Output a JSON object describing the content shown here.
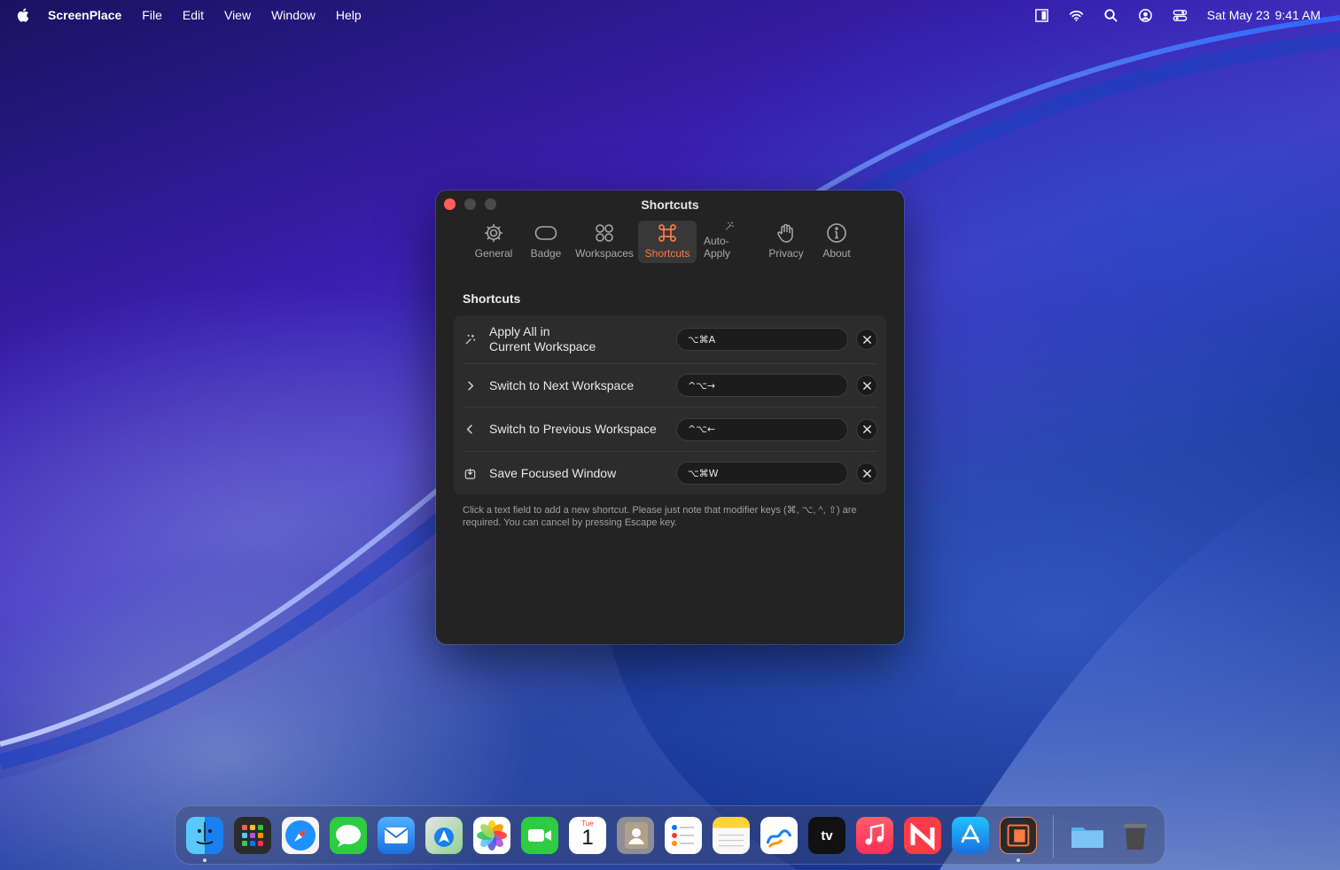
{
  "menubar": {
    "app_name": "ScreenPlace",
    "menus": [
      "File",
      "Edit",
      "View",
      "Window",
      "Help"
    ],
    "date": "Sat May 23",
    "time": "9:41 AM",
    "status_icons": [
      "screenplace-icon",
      "wifi-icon",
      "search-icon",
      "user-icon",
      "control-center-icon"
    ]
  },
  "window": {
    "title": "Shortcuts",
    "tabs": [
      {
        "label": "General",
        "icon": "gear-icon"
      },
      {
        "label": "Badge",
        "icon": "badge-icon"
      },
      {
        "label": "Workspaces",
        "icon": "grid-icon"
      },
      {
        "label": "Shortcuts",
        "icon": "command-icon",
        "active": true
      },
      {
        "label": "Auto-Apply",
        "icon": "magic-wand-icon"
      },
      {
        "label": "Privacy",
        "icon": "hand-icon"
      },
      {
        "label": "About",
        "icon": "info-icon"
      }
    ],
    "section_title": "Shortcuts",
    "rows": [
      {
        "label_line1": "Apply All in",
        "label_line2": "Current Workspace",
        "shortcut": "⌥⌘A",
        "icon": "magic-wand-icon"
      },
      {
        "label": "Switch to Next Workspace",
        "shortcut": "^⌥→",
        "icon": "chevron-right-icon"
      },
      {
        "label": "Switch to Previous Workspace",
        "shortcut": "^⌥←",
        "icon": "chevron-left-icon"
      },
      {
        "label": "Save Focused Window",
        "shortcut": "⌥⌘W",
        "icon": "save-window-icon"
      }
    ],
    "note": "Click a text field to add a new shortcut. Please just note that modifier keys (⌘, ⌥, ^, ⇧) are required. You can cancel by pressing Escape key."
  },
  "dock": {
    "calendar_month": "Tue",
    "calendar_day": "1",
    "tv_label": "tv",
    "apps": [
      "Finder",
      "Launchpad",
      "Safari",
      "Messages",
      "Mail",
      "Maps",
      "Photos",
      "FaceTime",
      "Calendar",
      "Contacts",
      "Reminders",
      "Notes",
      "Freeform",
      "TV",
      "Music",
      "News",
      "App Store",
      "ScreenPlace",
      "Downloads",
      "Trash"
    ]
  }
}
